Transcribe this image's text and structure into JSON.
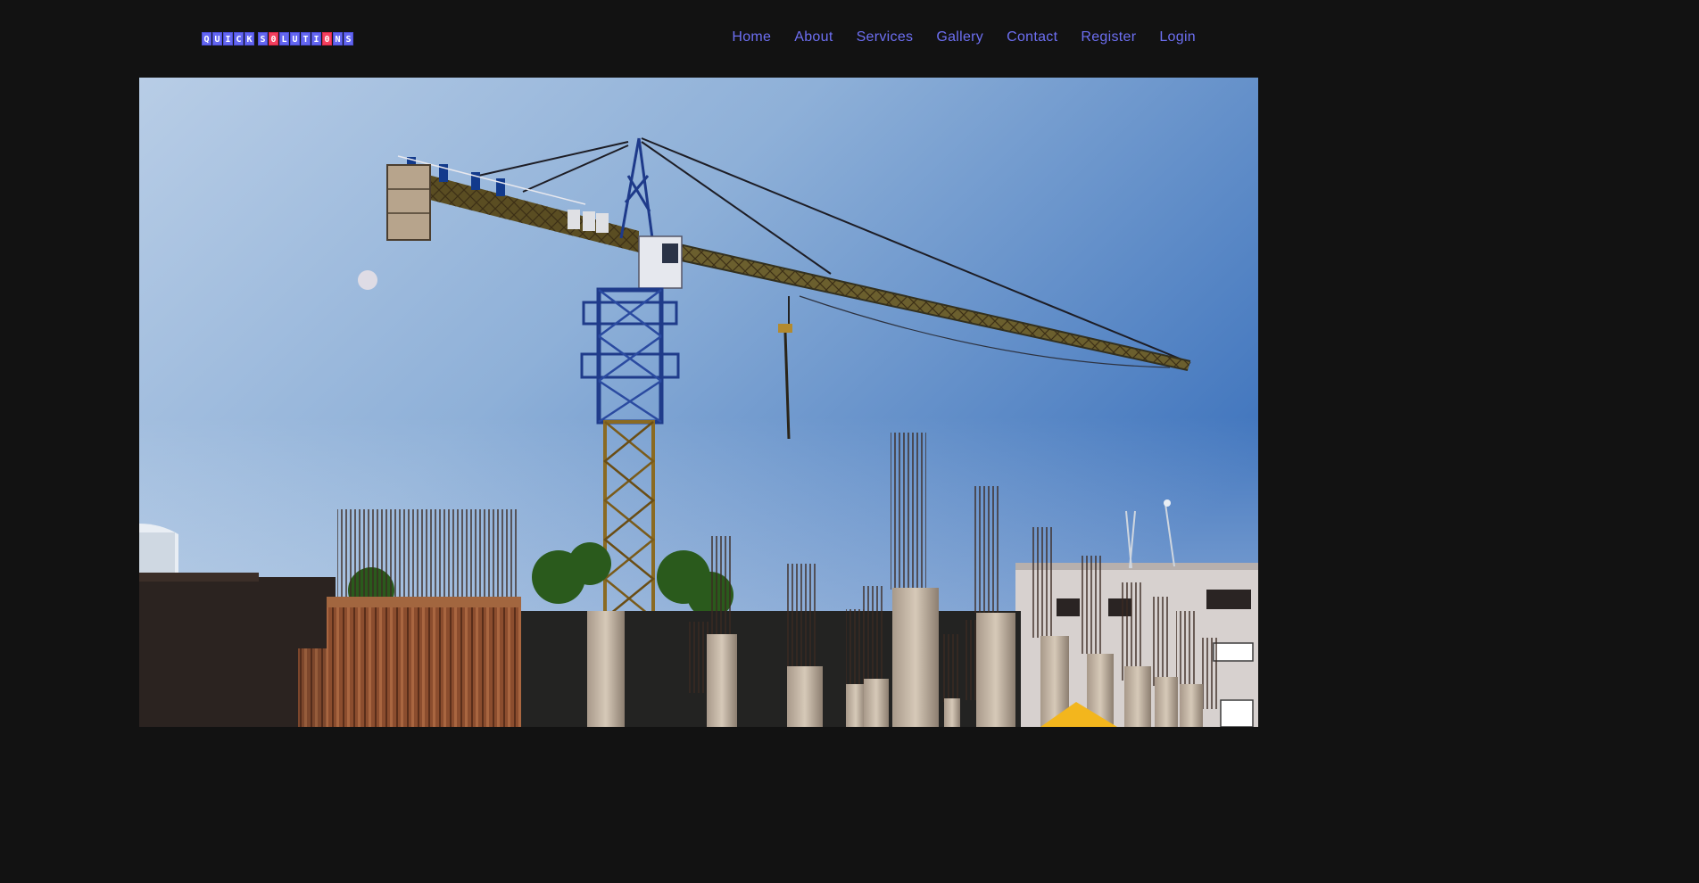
{
  "header": {
    "logo": {
      "groups": [
        [
          {
            "ch": "Q",
            "accent": false
          },
          {
            "ch": "U",
            "accent": false
          },
          {
            "ch": "I",
            "accent": false
          },
          {
            "ch": "C",
            "accent": false
          },
          {
            "ch": "K",
            "accent": false
          }
        ],
        [
          {
            "ch": "S",
            "accent": false
          },
          {
            "ch": "0",
            "accent": true
          },
          {
            "ch": "L",
            "accent": false
          },
          {
            "ch": "U",
            "accent": false
          },
          {
            "ch": "T",
            "accent": false
          },
          {
            "ch": "I",
            "accent": false
          },
          {
            "ch": "0",
            "accent": true
          },
          {
            "ch": "N",
            "accent": false
          },
          {
            "ch": "S",
            "accent": false
          }
        ]
      ],
      "tile_color": "#6366f1",
      "accent_color": "#f43f5e"
    },
    "nav": [
      {
        "label": "Home"
      },
      {
        "label": "About"
      },
      {
        "label": "Services"
      },
      {
        "label": "Gallery"
      },
      {
        "label": "Contact"
      },
      {
        "label": "Register"
      },
      {
        "label": "Login"
      }
    ],
    "nav_color": "#6d6ff2"
  },
  "hero": {
    "subject": "tower crane over construction site with concrete columns and rebar"
  },
  "colors": {
    "background": "#121212"
  }
}
